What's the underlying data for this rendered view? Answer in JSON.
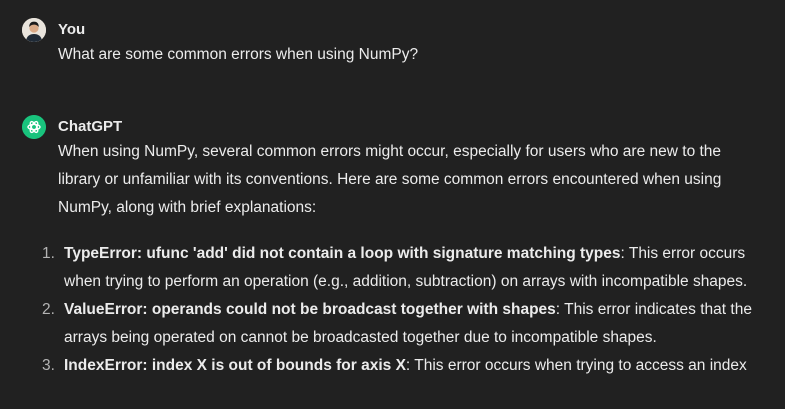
{
  "user_message": {
    "author": "You",
    "text": "What are some common errors when using NumPy?"
  },
  "assistant_message": {
    "author": "ChatGPT",
    "intro": "When using NumPy, several common errors might occur, especially for users who are new to the library or unfamiliar with its conventions. Here are some common errors encountered when using NumPy, along with brief explanations:",
    "items": [
      {
        "number": "1.",
        "name": "TypeError: ufunc 'add' did not contain a loop with signature matching types",
        "text": ": This error occurs when trying to perform an operation (e.g., addition, subtraction) on arrays with incompatible shapes."
      },
      {
        "number": "2.",
        "name": "ValueError: operands could not be broadcast together with shapes",
        "text": ": This error indicates that the arrays being operated on cannot be broadcasted together due to incompatible shapes."
      },
      {
        "number": "3.",
        "name": "IndexError: index X is out of bounds for axis X",
        "text": ": This error occurs when trying to access an index"
      }
    ]
  },
  "icons": {
    "user_avatar": "user-avatar-icon",
    "assistant_avatar": "chatgpt-logo-icon"
  },
  "colors": {
    "background": "#212121",
    "text": "#ececec",
    "muted": "#b4b4b4",
    "chatgpt_green": "#19c37d"
  }
}
